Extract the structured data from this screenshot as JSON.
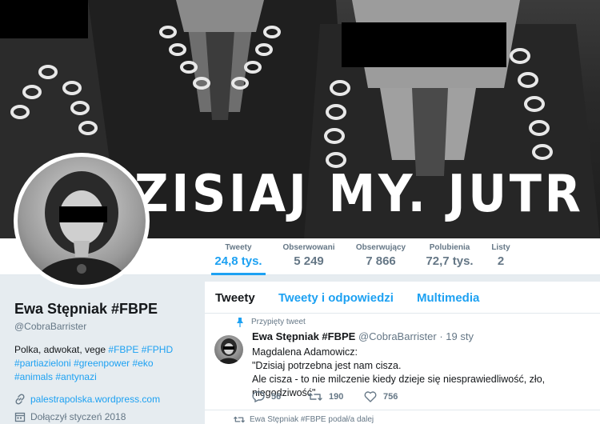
{
  "banner": {
    "text": "ZISIAJ MY. JUTR"
  },
  "nav": {
    "stats": [
      {
        "label": "Tweety",
        "value": "24,8 tys."
      },
      {
        "label": "Obserwowani",
        "value": "5 249"
      },
      {
        "label": "Obserwujący",
        "value": "7 866"
      },
      {
        "label": "Polubienia",
        "value": "72,7 tys."
      },
      {
        "label": "Listy",
        "value": "2"
      }
    ],
    "active_index": 0
  },
  "profile": {
    "name": "Ewa Stępniak #FBPE",
    "handle": "@CobraBarrister",
    "bio_line1_plain": "Polka, adwokat, vege ",
    "bio_tag1": "#FBPE",
    "bio_tag2": "#FPHD",
    "bio_tag3": "#partiazieloni",
    "bio_tag4": "#greenpower",
    "bio_tag5": "#eko",
    "bio_tag6": "#animals",
    "bio_tag7": "#antynazi",
    "website": "palestrapolska.wordpress.com",
    "joined": "Dołączył styczeń 2018",
    "link_icon": "link-icon",
    "calendar_icon": "calendar-icon"
  },
  "timeline": {
    "tabs": [
      {
        "label": "Tweety"
      },
      {
        "label": "Tweety i odpowiedzi"
      },
      {
        "label": "Multimedia"
      }
    ],
    "pinned_label": "Przypięty tweet",
    "tweet": {
      "author": "Ewa Stępniak #FBPE",
      "handle": "@CobraBarrister",
      "sep": "·",
      "date": "19 sty",
      "line1": "Magdalena Adamowicz:",
      "line2": "\"Dzisiaj potrzebna jest nam cisza.",
      "line3": "Ale cisza - to nie milczenie kiedy dzieje się niesprawiedliwość, zło, niegodziwość\"",
      "replies": "56",
      "retweets": "190",
      "likes": "756"
    },
    "retweeted_label": "Ewa Stępniak #FBPE podał/a dalej"
  },
  "colors": {
    "accent": "#1da1f2",
    "muted": "#657786",
    "text": "#14171a",
    "background": "#e6ecf0"
  }
}
